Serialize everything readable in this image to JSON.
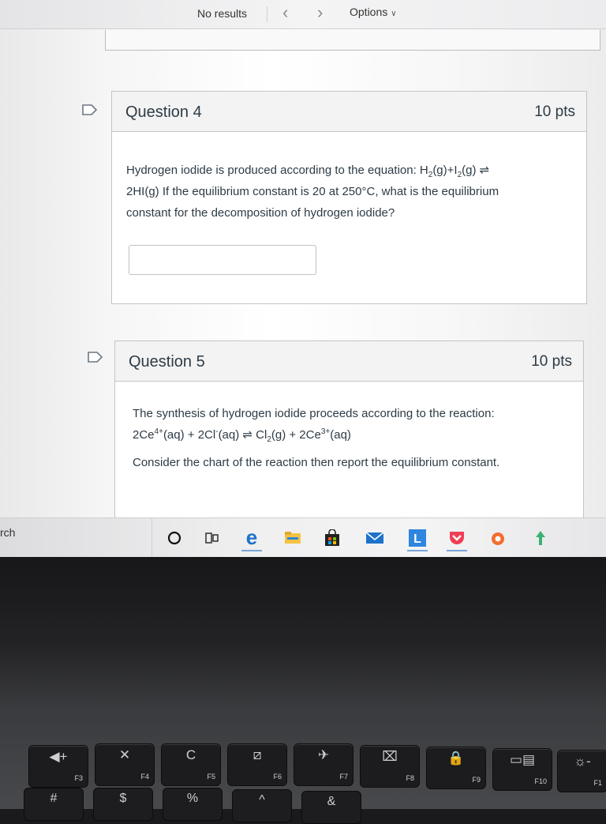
{
  "find_bar": {
    "results_text": "No results",
    "prev_icon": "chevron-left-icon",
    "next_icon": "chevron-right-icon",
    "options_label": "Options"
  },
  "questions": [
    {
      "title": "Question 4",
      "points": "10 pts",
      "lines": [
        {
          "pre": "Hydrogen iodide is produced according to the equation: H",
          "s1": "2",
          "m1": "(g)+I",
          "s2": "2",
          "post": "(g) ⇌"
        },
        {
          "text": "2HI(g) If the equilibrium constant is 20 at 250°C, what is the equilibrium"
        },
        {
          "text": "constant for the decomposition of hydrogen iodide?"
        }
      ],
      "answer_value": ""
    },
    {
      "title": "Question 5",
      "points": "10 pts",
      "intro": "The synthesis of hydrogen iodide proceeds according to the reaction:",
      "eq": {
        "a": "2Ce",
        "a_sup": "4+",
        "b": "(aq) + 2Cl",
        "b_sup": "-",
        "c": "(aq) ⇌ Cl",
        "c_sub": "2",
        "d": "(g) + 2Ce",
        "d_sup": "3+",
        "e": "(aq)"
      },
      "instruction": "Consider the chart of the reaction then report the equilibrium constant."
    }
  ],
  "taskbar": {
    "search_text": "rch",
    "icons": [
      "cortana-circle-icon",
      "task-view-icon",
      "edge-browser-icon",
      "file-explorer-icon",
      "store-icon",
      "mail-icon",
      "l-app-icon",
      "pocket-icon",
      "origin-icon",
      "app-arrow-icon"
    ]
  },
  "keyboard": {
    "fkeys": [
      {
        "glyph": "◀+",
        "label": "F3"
      },
      {
        "glyph": "✕",
        "label": "F4"
      },
      {
        "glyph": "C",
        "label": "F5"
      },
      {
        "glyph": "⧄",
        "label": "F6"
      },
      {
        "glyph": "✈",
        "label": "F7"
      },
      {
        "glyph": "⌧",
        "label": "F8"
      },
      {
        "glyph": "🔒",
        "label": "F9"
      },
      {
        "glyph": "▭▤",
        "label": "F10"
      },
      {
        "glyph": "☼-",
        "label": "F1"
      }
    ],
    "numkeys": [
      "#",
      "$",
      "%",
      "^",
      "&"
    ]
  },
  "colors": {
    "text": "#2d3b45",
    "header_bg": "#f3f3f4",
    "border": "#c4c4c4",
    "flag": "#6b7780"
  }
}
